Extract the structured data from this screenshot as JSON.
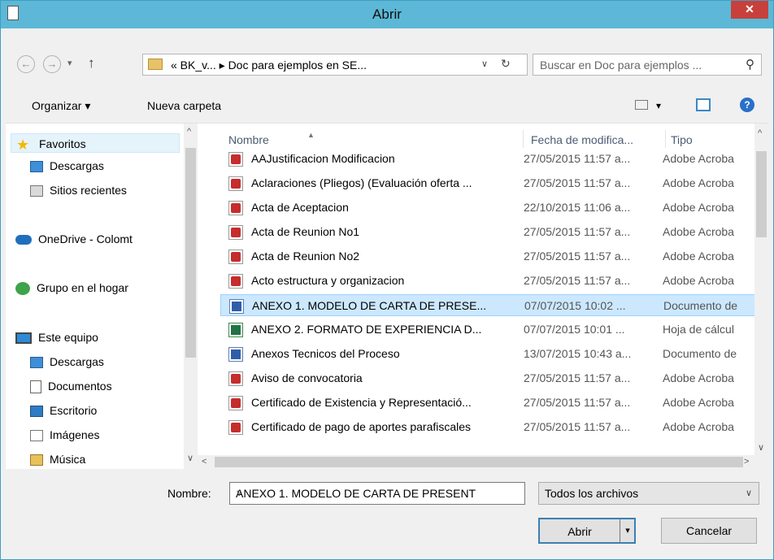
{
  "window": {
    "title": "Abrir",
    "close_glyph": "✕"
  },
  "nav": {
    "back_glyph": "←",
    "forward_glyph": "→",
    "recent_glyph": "▾",
    "up_glyph": "↑",
    "address_path": "« BK_v... ▸ Doc para ejemplos en SE...",
    "address_dropdown": "∨",
    "refresh_glyph": "↻",
    "search_placeholder": "Buscar en Doc para ejemplos ...",
    "search_icon": "⚲"
  },
  "toolbar": {
    "organize_label": "Organizar ▾",
    "new_folder_label": "Nueva carpeta",
    "view_dropdown": "▾",
    "help_glyph": "?"
  },
  "sidebar": {
    "items": [
      {
        "label": "Favoritos",
        "icon": "star-icon"
      },
      {
        "label": "Descargas",
        "icon": "downloads-icon"
      },
      {
        "label": "Sitios recientes",
        "icon": "recent-places-icon"
      },
      {
        "label": "OneDrive - Colomt",
        "icon": "onedrive-icon"
      },
      {
        "label": "Grupo en el hogar",
        "icon": "homegroup-icon"
      },
      {
        "label": "Este equipo",
        "icon": "computer-icon"
      },
      {
        "label": "Descargas",
        "icon": "downloads-icon"
      },
      {
        "label": "Documentos",
        "icon": "documents-icon"
      },
      {
        "label": "Escritorio",
        "icon": "desktop-icon"
      },
      {
        "label": "Imágenes",
        "icon": "pictures-icon"
      },
      {
        "label": "Música",
        "icon": "music-icon"
      }
    ],
    "scroll_up": "^",
    "scroll_down": "∨"
  },
  "filelist": {
    "headers": {
      "name": "Nombre",
      "date": "Fecha de modifica...",
      "type": "Tipo"
    },
    "rows": [
      {
        "name": "AAJustificacion Modificacion",
        "date": "27/05/2015 11:57 a...",
        "type": "Adobe Acroba",
        "icon": "pdf-file-icon"
      },
      {
        "name": "Aclaraciones (Pliegos) (Evaluación oferta ...",
        "date": "27/05/2015 11:57 a...",
        "type": "Adobe Acroba",
        "icon": "pdf-file-icon"
      },
      {
        "name": "Acta de Aceptacion",
        "date": "22/10/2015 11:06 a...",
        "type": "Adobe Acroba",
        "icon": "pdf-file-icon"
      },
      {
        "name": "Acta de Reunion No1",
        "date": "27/05/2015 11:57 a...",
        "type": "Adobe Acroba",
        "icon": "pdf-file-icon"
      },
      {
        "name": "Acta de Reunion No2",
        "date": "27/05/2015 11:57 a...",
        "type": "Adobe Acroba",
        "icon": "pdf-file-icon"
      },
      {
        "name": "Acto estructura y organizacion",
        "date": "27/05/2015 11:57 a...",
        "type": "Adobe Acroba",
        "icon": "pdf-file-icon"
      },
      {
        "name": "ANEXO 1. MODELO DE CARTA DE PRESE...",
        "date": "07/07/2015 10:02 ...",
        "type": "Documento de",
        "icon": "word-file-icon"
      },
      {
        "name": "ANEXO 2. FORMATO DE EXPERIENCIA D...",
        "date": "07/07/2015 10:01 ...",
        "type": "Hoja de cálcul",
        "icon": "excel-file-icon"
      },
      {
        "name": "Anexos Tecnicos del Proceso",
        "date": "13/07/2015 10:43 a...",
        "type": "Documento de",
        "icon": "word-file-icon"
      },
      {
        "name": "Aviso de convocatoria",
        "date": "27/05/2015 11:57 a...",
        "type": "Adobe Acroba",
        "icon": "pdf-file-icon"
      },
      {
        "name": "Certificado de Existencia y Representació...",
        "date": "27/05/2015 11:57 a...",
        "type": "Adobe Acroba",
        "icon": "pdf-file-icon"
      },
      {
        "name": "Certificado de pago de aportes parafiscales",
        "date": "27/05/2015 11:57 a...",
        "type": "Adobe Acroba",
        "icon": "pdf-file-icon"
      }
    ],
    "scroll_left": "<",
    "scroll_right": ">",
    "scroll_up": "^",
    "scroll_down": "∨"
  },
  "bottom": {
    "name_label": "Nombre:",
    "name_value": "ANEXO 1. MODELO DE CARTA DE PRESENT",
    "name_dropdown": "∨",
    "filter_value": "Todos los archivos",
    "filter_dropdown": "∨",
    "open_label": "Abrir",
    "open_dropdown": "▾",
    "cancel_label": "Cancelar"
  },
  "colors": {
    "titlebar": "#5cb8d6",
    "close_button": "#c8403b",
    "selection": "#cce8ff"
  }
}
